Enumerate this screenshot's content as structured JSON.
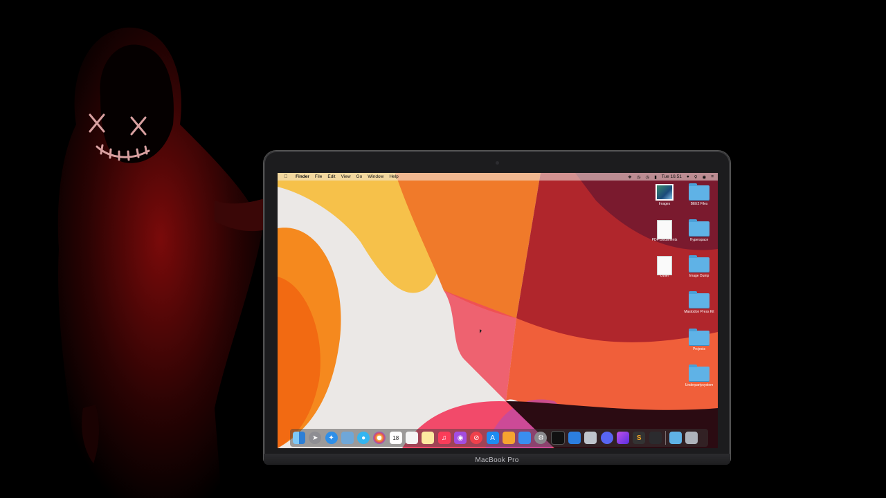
{
  "laptop": {
    "label": "MacBook Pro"
  },
  "menubar": {
    "apple_icon": "apple-icon",
    "app_name": "Finder",
    "items": [
      "File",
      "Edit",
      "View",
      "Go",
      "Window",
      "Help"
    ],
    "clock": "Tue 16:51"
  },
  "desktop_icons": [
    {
      "label": "Images",
      "icon": "photo"
    },
    {
      "label": "BEE2 Files",
      "icon": "folder"
    },
    {
      "label": "PDF Documents",
      "icon": "document"
    },
    {
      "label": "Hyperspace",
      "icon": "folder"
    },
    {
      "label": "Other",
      "icon": "document"
    },
    {
      "label": "Image Dump",
      "icon": "folder"
    },
    {
      "label": "Mastodon Press Kit",
      "icon": "folder"
    },
    {
      "label": "Projects",
      "icon": "folder"
    },
    {
      "label": "Underpartysystem",
      "icon": "folder"
    }
  ],
  "dock": {
    "calendar_day": "18",
    "items": [
      "finder",
      "launchpad",
      "safari",
      "preview",
      "messages",
      "photos",
      "calendar",
      "reminders",
      "notes",
      "music",
      "podcasts",
      "news",
      "app-store",
      "pages",
      "keynote",
      "system-preferences",
      "terminal",
      "xcode",
      "image-capture",
      "discord",
      "affinity-photo",
      "sublime-text",
      "istat-menus",
      "downloads-folder",
      "trash"
    ]
  },
  "colors": {
    "folder": "#5fb2e6",
    "wallpaper_orange": "#f07a2a",
    "wallpaper_red": "#b0262c",
    "wallpaper_yellow": "#f6c14a"
  }
}
